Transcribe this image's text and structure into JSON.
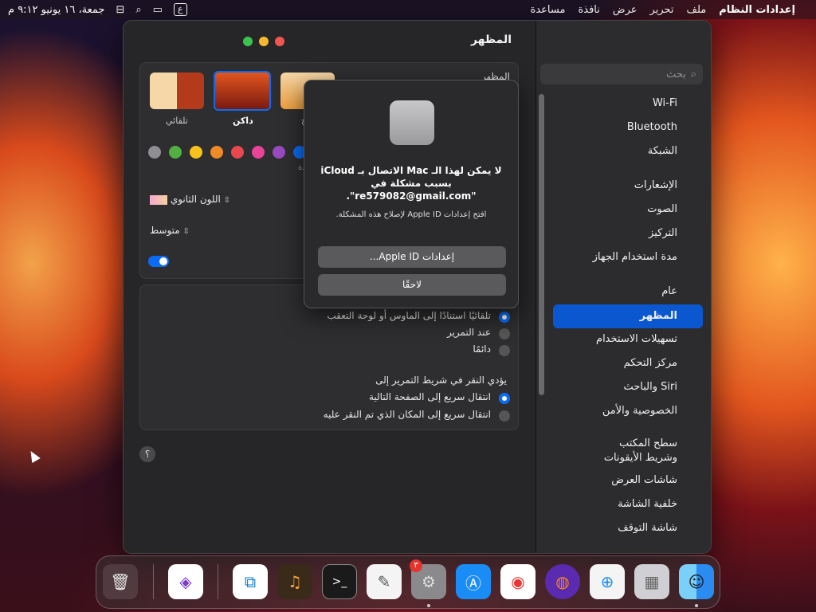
{
  "menubar": {
    "app_name": "إعدادات النظام",
    "menus": [
      "ملف",
      "تحرير",
      "عرض",
      "نافذة",
      "مساعدة"
    ],
    "input_source": "ع",
    "datetime": "جمعة، ١٦ يونيو ٩:١٢ م"
  },
  "window": {
    "title": "المظهر",
    "search_placeholder": "بحث",
    "sidebar": {
      "items": [
        {
          "label": "Wi-Fi"
        },
        {
          "label": "Bluetooth"
        },
        {
          "label": "الشبكة"
        },
        {
          "label": "الإشعارات"
        },
        {
          "label": "الصوت"
        },
        {
          "label": "التركيز"
        },
        {
          "label": "مدة استخدام الجهاز"
        },
        {
          "label": "عام"
        },
        {
          "label": "المظهر",
          "selected": true
        },
        {
          "label": "تسهيلات الاستخدام"
        },
        {
          "label": "مركز التحكم"
        },
        {
          "label": "Siri والباحث"
        },
        {
          "label": "الخصوصية والأمن"
        },
        {
          "label": "سطح المكتب"
        },
        {
          "label": "وشريط الأيقونات"
        },
        {
          "label": "شاشات العرض"
        },
        {
          "label": "خلفية الشاشة"
        },
        {
          "label": "شاشة التوقف"
        }
      ]
    },
    "appearance": {
      "section_label": "المظهر",
      "options": [
        "تلقائي",
        "داكن",
        "ح"
      ],
      "selected": "داكن",
      "accent_label_fragment": "دة",
      "highlight_label": "اللون الثانوي",
      "sidebar_icon_size": "متوسط"
    },
    "scroll": {
      "show_options": [
        "تلقائيًا استنادًا إلى الماوس أو لوحة التعقب",
        "عند التمرير",
        "دائمًا"
      ],
      "show_selected": 0,
      "click_title": "يؤدي النقر في شريط التمرير إلى",
      "click_options": [
        "انتقال سريع إلى الصفحة التالية",
        "انتقال سريع إلى المكان الذي تم النقر عليه"
      ],
      "click_selected": 0
    },
    "help": "؟"
  },
  "dialog": {
    "message_line1": "لا يمكن لهذا الـ Mac الاتصال بـ iCloud",
    "message_line2": "بسبب مشكلة في",
    "message_line3": "\"re579082@gmail.com\".",
    "sub": "افتح إعدادات Apple ID لإصلاح هذه المشكلة.",
    "primary_button": "إعدادات Apple ID...",
    "secondary_button": "لاحقًا"
  },
  "dock": {
    "badge": "٣",
    "apps": [
      "finder-icon",
      "launchpad-icon",
      "safari-icon",
      "firefox-icon",
      "chrome-icon",
      "app-store-icon",
      "system-settings-icon",
      "textedit-icon",
      "terminal-icon",
      "garageband-icon",
      "vscode-icon",
      "visual-studio-icon",
      "trash-icon"
    ]
  },
  "colors": {
    "accent": "#0a57d0",
    "accent_swatches": [
      "#8e8e93",
      "#52b043",
      "#f7c31a",
      "#f08a24",
      "#e8484e",
      "#e9439a",
      "#9a4ac0",
      "#0a6cf5"
    ]
  }
}
